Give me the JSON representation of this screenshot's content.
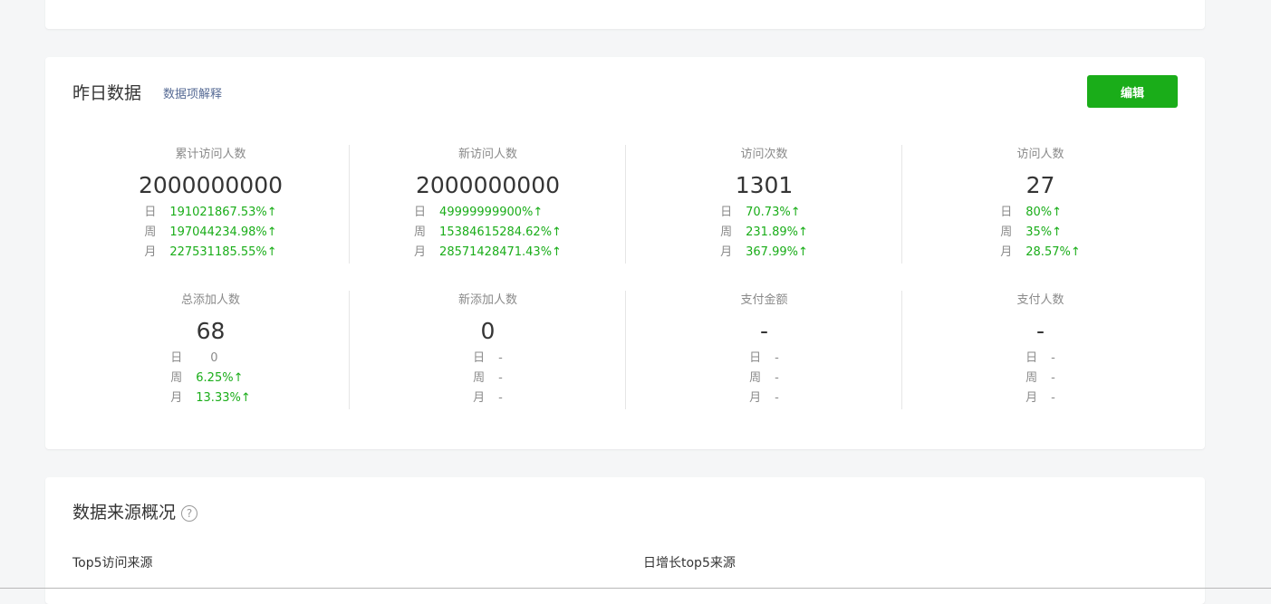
{
  "yesterday": {
    "title": "昨日数据",
    "explain_link": "数据项解释",
    "edit_button": "编辑",
    "metrics": [
      {
        "label": "累计访问人数",
        "value": "2000000000",
        "rows": [
          {
            "k": "日",
            "v": "191021867.53%↑"
          },
          {
            "k": "周",
            "v": "197044234.98%↑"
          },
          {
            "k": "月",
            "v": "227531185.55%↑"
          }
        ]
      },
      {
        "label": "新访问人数",
        "value": "2000000000",
        "rows": [
          {
            "k": "日",
            "v": "49999999900%↑"
          },
          {
            "k": "周",
            "v": "15384615284.62%↑"
          },
          {
            "k": "月",
            "v": "28571428471.43%↑"
          }
        ]
      },
      {
        "label": "访问次数",
        "value": "1301",
        "rows": [
          {
            "k": "日",
            "v": "70.73%↑"
          },
          {
            "k": "周",
            "v": "231.89%↑"
          },
          {
            "k": "月",
            "v": "367.99%↑"
          }
        ]
      },
      {
        "label": "访问人数",
        "value": "27",
        "rows": [
          {
            "k": "日",
            "v": "80%↑"
          },
          {
            "k": "周",
            "v": "35%↑"
          },
          {
            "k": "月",
            "v": "28.57%↑"
          }
        ]
      },
      {
        "label": "总添加人数",
        "value": "68",
        "rows": [
          {
            "k": "日",
            "v": "0"
          },
          {
            "k": "周",
            "v": "6.25%↑"
          },
          {
            "k": "月",
            "v": "13.33%↑"
          }
        ]
      },
      {
        "label": "新添加人数",
        "value": "0",
        "rows": [
          {
            "k": "日",
            "v": "-"
          },
          {
            "k": "周",
            "v": "-"
          },
          {
            "k": "月",
            "v": "-"
          }
        ]
      },
      {
        "label": "支付金额",
        "value": "-",
        "rows": [
          {
            "k": "日",
            "v": "-"
          },
          {
            "k": "周",
            "v": "-"
          },
          {
            "k": "月",
            "v": "-"
          }
        ]
      },
      {
        "label": "支付人数",
        "value": "-",
        "rows": [
          {
            "k": "日",
            "v": "-"
          },
          {
            "k": "周",
            "v": "-"
          },
          {
            "k": "月",
            "v": "-"
          }
        ]
      }
    ]
  },
  "source": {
    "title": "数据来源概况",
    "help_icon": "question-circle-icon",
    "top5_label": "Top5访问来源",
    "growth_label": "日增长top5来源"
  },
  "colors": {
    "accent_green": "#1aad19",
    "link_blue": "#576b95",
    "muted_gray": "#8a8a8a",
    "page_bg": "#f5f6f7"
  }
}
